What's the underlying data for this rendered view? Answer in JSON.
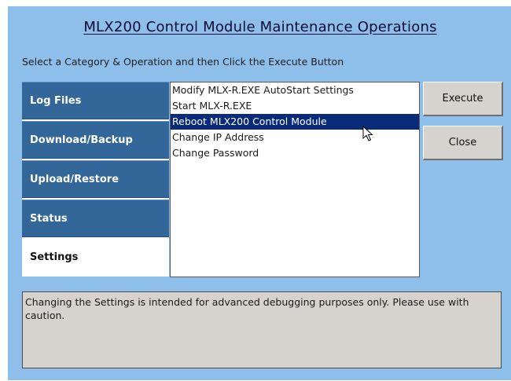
{
  "title": "MLX200 Control Module Maintenance Operations",
  "instruction": "Select a Category & Operation and then Click the Execute Button",
  "categories": [
    {
      "label": "Log Files",
      "selected": false
    },
    {
      "label": "Download/Backup",
      "selected": false
    },
    {
      "label": "Upload/Restore",
      "selected": false
    },
    {
      "label": "Status",
      "selected": false
    },
    {
      "label": "Settings",
      "selected": true
    }
  ],
  "operations": [
    {
      "label": "Modify MLX-R.EXE AutoStart Settings",
      "selected": false
    },
    {
      "label": "Start MLX-R.EXE",
      "selected": false
    },
    {
      "label": "Reboot MLX200 Control Module",
      "selected": true
    },
    {
      "label": "Change IP Address",
      "selected": false
    },
    {
      "label": "Change Password",
      "selected": false
    }
  ],
  "buttons": {
    "execute": "Execute",
    "close": "Close"
  },
  "message": "Changing the Settings is intended for advanced debugging purposes only. Please use with caution.",
  "colors": {
    "background": "#8ebfea",
    "category": "#336699",
    "selection": "#0a2a7a",
    "button_face": "#d6d3ce"
  },
  "icons": {
    "cursor": "mouse-pointer-icon"
  }
}
